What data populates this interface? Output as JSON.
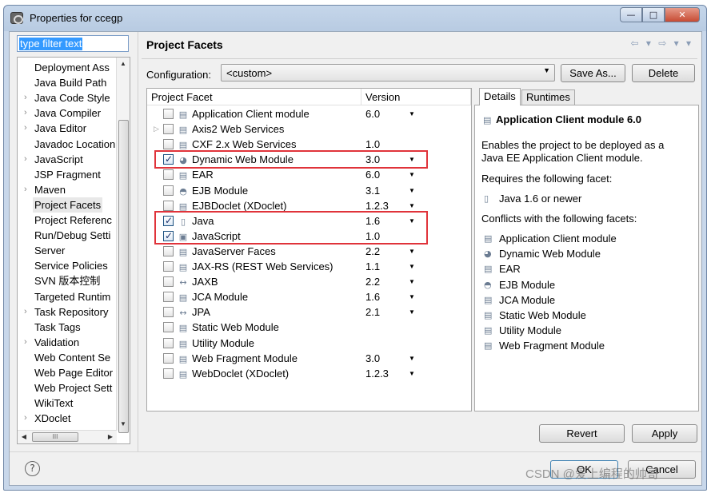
{
  "window": {
    "title": "Properties for ccegp",
    "minimize": "—",
    "maximize": "□",
    "close": "✕"
  },
  "filter": {
    "text": "type filter text"
  },
  "tree": {
    "items": [
      {
        "label": "Deployment Ass",
        "expandable": false
      },
      {
        "label": "Java Build Path",
        "expandable": false
      },
      {
        "label": "Java Code Style",
        "expandable": true
      },
      {
        "label": "Java Compiler",
        "expandable": true
      },
      {
        "label": "Java Editor",
        "expandable": true
      },
      {
        "label": "Javadoc Location",
        "expandable": false
      },
      {
        "label": "JavaScript",
        "expandable": true
      },
      {
        "label": "JSP Fragment",
        "expandable": false
      },
      {
        "label": "Maven",
        "expandable": true
      },
      {
        "label": "Project Facets",
        "expandable": false,
        "selected": true
      },
      {
        "label": "Project Referenc",
        "expandable": false
      },
      {
        "label": "Run/Debug Setti",
        "expandable": false
      },
      {
        "label": "Server",
        "expandable": false
      },
      {
        "label": "Service Policies",
        "expandable": false
      },
      {
        "label": "SVN 版本控制",
        "expandable": false
      },
      {
        "label": "Targeted Runtim",
        "expandable": false
      },
      {
        "label": "Task Repository",
        "expandable": true
      },
      {
        "label": "Task Tags",
        "expandable": false
      },
      {
        "label": "Validation",
        "expandable": true
      },
      {
        "label": "Web Content Se",
        "expandable": false
      },
      {
        "label": "Web Page Editor",
        "expandable": false
      },
      {
        "label": "Web Project Sett",
        "expandable": false
      },
      {
        "label": "WikiText",
        "expandable": false
      },
      {
        "label": "XDoclet",
        "expandable": true
      }
    ],
    "hscroll_grip": "III"
  },
  "page": {
    "title": "Project Facets",
    "nav": "⇦ ▾ ⇨ ▾ ▾"
  },
  "configuration": {
    "label": "Configuration:",
    "value": "<custom>",
    "save_as": "Save As...",
    "delete": "Delete"
  },
  "facets": {
    "col_facet": "Project Facet",
    "col_version": "Version",
    "rows": [
      {
        "name": "Application Client module",
        "version": "6.0",
        "checked": false,
        "dropdown": true,
        "icon": "doc",
        "expander": false
      },
      {
        "name": "Axis2 Web Services",
        "version": "",
        "checked": false,
        "dropdown": false,
        "icon": "doc",
        "expander": true
      },
      {
        "name": "CXF 2.x Web Services",
        "version": "1.0",
        "checked": false,
        "dropdown": false,
        "icon": "doc",
        "expander": false
      },
      {
        "name": "Dynamic Web Module",
        "version": "3.0",
        "checked": true,
        "dropdown": true,
        "icon": "web",
        "expander": false
      },
      {
        "name": "EAR",
        "version": "6.0",
        "checked": false,
        "dropdown": true,
        "icon": "doc",
        "expander": false
      },
      {
        "name": "EJB Module",
        "version": "3.1",
        "checked": false,
        "dropdown": true,
        "icon": "bean",
        "expander": false
      },
      {
        "name": "EJBDoclet (XDoclet)",
        "version": "1.2.3",
        "checked": false,
        "dropdown": true,
        "icon": "doc",
        "expander": false
      },
      {
        "name": "Java",
        "version": "1.6",
        "checked": true,
        "dropdown": true,
        "icon": "jar",
        "expander": false
      },
      {
        "name": "JavaScript",
        "version": "1.0",
        "checked": true,
        "dropdown": false,
        "icon": "js",
        "expander": false
      },
      {
        "name": "JavaServer Faces",
        "version": "2.2",
        "checked": false,
        "dropdown": true,
        "icon": "doc",
        "expander": false
      },
      {
        "name": "JAX-RS (REST Web Services)",
        "version": "1.1",
        "checked": false,
        "dropdown": true,
        "icon": "doc",
        "expander": false
      },
      {
        "name": "JAXB",
        "version": "2.2",
        "checked": false,
        "dropdown": true,
        "icon": "jaxb",
        "expander": false
      },
      {
        "name": "JCA Module",
        "version": "1.6",
        "checked": false,
        "dropdown": true,
        "icon": "doc",
        "expander": false
      },
      {
        "name": "JPA",
        "version": "2.1",
        "checked": false,
        "dropdown": true,
        "icon": "jaxb",
        "expander": false
      },
      {
        "name": "Static Web Module",
        "version": "",
        "checked": false,
        "dropdown": false,
        "icon": "doc",
        "expander": false
      },
      {
        "name": "Utility Module",
        "version": "",
        "checked": false,
        "dropdown": false,
        "icon": "doc",
        "expander": false
      },
      {
        "name": "Web Fragment Module",
        "version": "3.0",
        "checked": false,
        "dropdown": true,
        "icon": "doc",
        "expander": false
      },
      {
        "name": "WebDoclet (XDoclet)",
        "version": "1.2.3",
        "checked": false,
        "dropdown": true,
        "icon": "doc",
        "expander": false
      }
    ]
  },
  "details": {
    "tab_details": "Details",
    "tab_runtimes": "Runtimes",
    "title": "Application Client module 6.0",
    "description_line1": "Enables the project to be deployed as a",
    "description_line2": "Java EE Application Client module.",
    "requires_label": "Requires the following facet:",
    "requires": [
      {
        "label": "Java 1.6 or newer",
        "icon": "jar"
      }
    ],
    "conflicts_label": "Conflicts with the following facets:",
    "conflicts": [
      {
        "label": "Application Client module",
        "icon": "doc"
      },
      {
        "label": "Dynamic Web Module",
        "icon": "web"
      },
      {
        "label": "EAR",
        "icon": "doc"
      },
      {
        "label": "EJB Module",
        "icon": "bean"
      },
      {
        "label": "JCA Module",
        "icon": "doc"
      },
      {
        "label": "Static Web Module",
        "icon": "doc"
      },
      {
        "label": "Utility Module",
        "icon": "doc"
      },
      {
        "label": "Web Fragment Module",
        "icon": "doc"
      }
    ]
  },
  "buttons": {
    "revert": "Revert",
    "apply": "Apply",
    "ok": "OK",
    "cancel": "Cancel",
    "help": "?"
  },
  "watermark": "CSDN @爱上编程的帅哥",
  "icon_glyphs": {
    "doc": "▤",
    "web": "◕",
    "bean": "◓",
    "jar": "▯",
    "js": "▣",
    "jaxb": "↔"
  },
  "colors": {
    "highlight": "#e0333a",
    "selection": "#3399ff"
  }
}
